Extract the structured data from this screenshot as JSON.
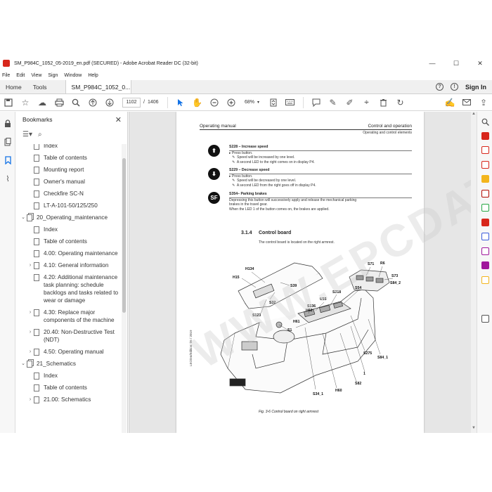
{
  "window": {
    "title": "SM_P984C_1052_05-2019_en.pdf (SECURED) - Adobe Acrobat Reader DC (32-bit)",
    "minimize": "—",
    "maximize": "☐",
    "close": "✕"
  },
  "menu": [
    "File",
    "Edit",
    "View",
    "Sign",
    "Window",
    "Help"
  ],
  "tabs": {
    "home": "Home",
    "tools": "Tools",
    "document": "SM_P984C_1052_0...",
    "close": "×",
    "help": "?",
    "bell": "!",
    "signin": "Sign In"
  },
  "toolbar": {
    "page_current": "1102",
    "page_sep": "/",
    "page_total": "1406",
    "zoom": "68%"
  },
  "bookmarks": {
    "title": "Bookmarks",
    "close": "✕",
    "items": [
      {
        "level": 1,
        "caret": "",
        "icon": "page",
        "label": "Index"
      },
      {
        "level": 1,
        "caret": "",
        "icon": "page",
        "label": "Table of contents"
      },
      {
        "level": 1,
        "caret": "",
        "icon": "page",
        "label": "Mounting report"
      },
      {
        "level": 1,
        "caret": "",
        "icon": "page",
        "label": "Owner's manual"
      },
      {
        "level": 1,
        "caret": "",
        "icon": "page",
        "label": "Checkfire SC-N"
      },
      {
        "level": 1,
        "caret": "",
        "icon": "page",
        "label": "LT-A-101-50/125/250"
      },
      {
        "level": 0,
        "caret": "⌄",
        "icon": "multi",
        "label": "20_Operating_maintenance"
      },
      {
        "level": 1,
        "caret": "",
        "icon": "page",
        "label": "Index"
      },
      {
        "level": 1,
        "caret": "",
        "icon": "page",
        "label": "Table of contents"
      },
      {
        "level": 1,
        "caret": "",
        "icon": "page",
        "label": "4.00: Operating maintenance"
      },
      {
        "level": 1,
        "caret": "›",
        "icon": "page",
        "label": "4.10: General information"
      },
      {
        "level": 1,
        "caret": "",
        "icon": "page",
        "label": "4.20: Additional maintenance task planning: schedule backlogs and tasks related to wear or damage"
      },
      {
        "level": 1,
        "caret": "›",
        "icon": "page",
        "label": "4.30: Replace major components of the machine"
      },
      {
        "level": 1,
        "caret": "›",
        "icon": "page",
        "label": "20.40: Non-Destructive Test (NDT)"
      },
      {
        "level": 1,
        "caret": "›",
        "icon": "page",
        "label": "4.50: Operating manual"
      },
      {
        "level": 0,
        "caret": "⌄",
        "icon": "multi",
        "label": "21_Schematics"
      },
      {
        "level": 1,
        "caret": "",
        "icon": "page",
        "label": "Index"
      },
      {
        "level": 1,
        "caret": "",
        "icon": "page",
        "label": "Table of contents"
      },
      {
        "level": 1,
        "caret": "›",
        "icon": "page",
        "label": "21.00: Schematics"
      }
    ]
  },
  "document": {
    "header_left": "Operating manual",
    "header_right": "Control and operation",
    "header_sub": "Operating and control elements",
    "controls": [
      {
        "icon": "⬆",
        "title": "S228 – Increase speed",
        "lines": [
          "▸ Press button.",
          "   ✎  Speed will be increased by one level.",
          "   ✎  A second LED to the right comes on in display P4."
        ]
      },
      {
        "icon": "⬇",
        "title": "S229 – Decrease speed",
        "lines": [
          "▸ Press button.",
          "   ✎  Speed will be decreased by one level.",
          "   ✎  A second LED from the right goes off in display P4."
        ]
      },
      {
        "icon": "SF",
        "title": "S354– Parking brakes",
        "lines": [
          "Depressing this button will successively apply and release the mechanical parking",
          "brakes in the travel gear.",
          "When the LED 1 of the button comes on, the brakes are applied."
        ]
      }
    ],
    "section_number": "3.1.4",
    "section_title": "Control board",
    "section_desc": "The control board is located on the right armrest.",
    "figure_labels": [
      "H134",
      "H15",
      "S39",
      "S32",
      "S123",
      "S71",
      "R6",
      "S73",
      "S84_2",
      "S54",
      "S218",
      "U15",
      "S136",
      "H62",
      "H61",
      "S1",
      "S275",
      "S84_1",
      "1",
      "S82",
      "H60",
      "S34_1"
    ],
    "figure_caption": "Fig. 3-6     Control board on right armrest",
    "side_text": "LEO/en/Edition: 05 / 2019",
    "watermark": "WWW.EPCDATA.COM"
  },
  "right_tools": [
    {
      "name": "export-pdf",
      "color": "#d8271c"
    },
    {
      "name": "create-pdf",
      "color": "#d8271c"
    },
    {
      "name": "edit-pdf",
      "color": "#d8271c"
    },
    {
      "name": "comment",
      "color": "#f3b51d"
    },
    {
      "name": "combine",
      "color": "#b30b00"
    },
    {
      "name": "organize",
      "color": "#28a745"
    },
    {
      "name": "redact",
      "color": "#d8271c"
    },
    {
      "name": "protect",
      "color": "#3b5bdb"
    },
    {
      "name": "fill-sign",
      "color": "#a0179c"
    },
    {
      "name": "send-signature",
      "color": "#a0179c"
    },
    {
      "name": "share",
      "color": "#f3b51d"
    },
    {
      "name": "more-tools",
      "color": "#555555"
    }
  ]
}
